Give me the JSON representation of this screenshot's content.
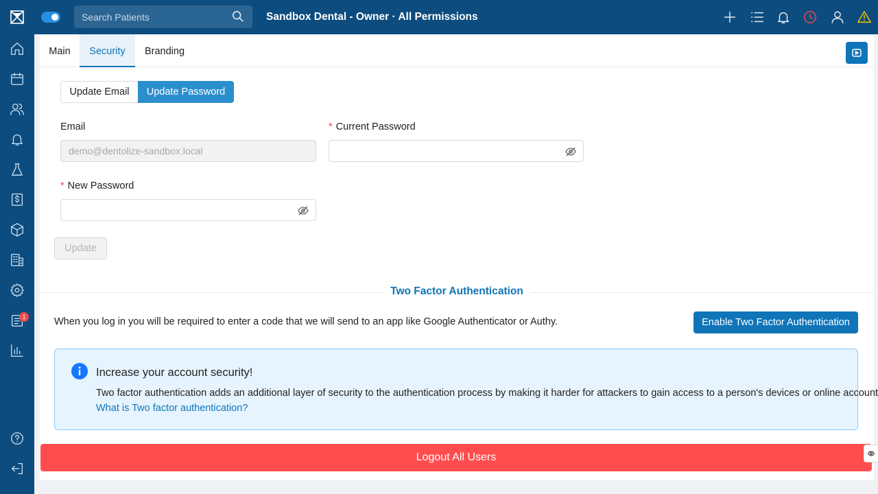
{
  "header": {
    "search_placeholder": "Search Patients",
    "practice_title": "Sandbox Dental - Owner · All Permissions",
    "icons": [
      "plus-icon",
      "list-icon",
      "bell-icon",
      "clock-icon",
      "user-icon",
      "warning-icon"
    ]
  },
  "sidebar": {
    "items": [
      "home-icon",
      "calendar-icon",
      "patients-icon",
      "notifications-icon",
      "lab-icon",
      "billing-icon",
      "inventory-icon",
      "building-icon",
      "settings-icon",
      "tasks-icon",
      "reports-icon",
      "help-icon",
      "logout-icon"
    ],
    "tasks_badge": "1"
  },
  "tabs": [
    {
      "label": "Main",
      "active": false
    },
    {
      "label": "Security",
      "active": true
    },
    {
      "label": "Branding",
      "active": false
    }
  ],
  "segmented": {
    "update_email": "Update Email",
    "update_password": "Update Password",
    "selected": "Update Password"
  },
  "form": {
    "email_label": "Email",
    "email_value": "demo@dentolize-sandbox.local",
    "current_password_label": "Current Password",
    "new_password_label": "New Password",
    "required_mark": "*",
    "update_label": "Update"
  },
  "two_factor": {
    "title": "Two Factor Authentication",
    "description": "When you log in you will be required to enter a code that we will send to an app like Google Authenticator or Authy.",
    "enable_label": "Enable Two Factor Authentication",
    "alert_title": "Increase your account security!",
    "alert_body": "Two factor authentication adds an additional layer of security to the authentication process by making it harder for attackers to gain access to a person's devices or online accounts.",
    "alert_link": "What is Two factor authentication?"
  },
  "logout_all_label": "Logout All Users",
  "colors": {
    "sidebar_bg": "#0d4c7e",
    "accent": "#0f74b8",
    "segment_active": "#2b8fce",
    "danger": "#ff4d4f",
    "info_bg": "#e6f4ff",
    "info_border": "#8cc6f5",
    "warning": "#f5c400",
    "clock_red": "#f04a4a"
  }
}
